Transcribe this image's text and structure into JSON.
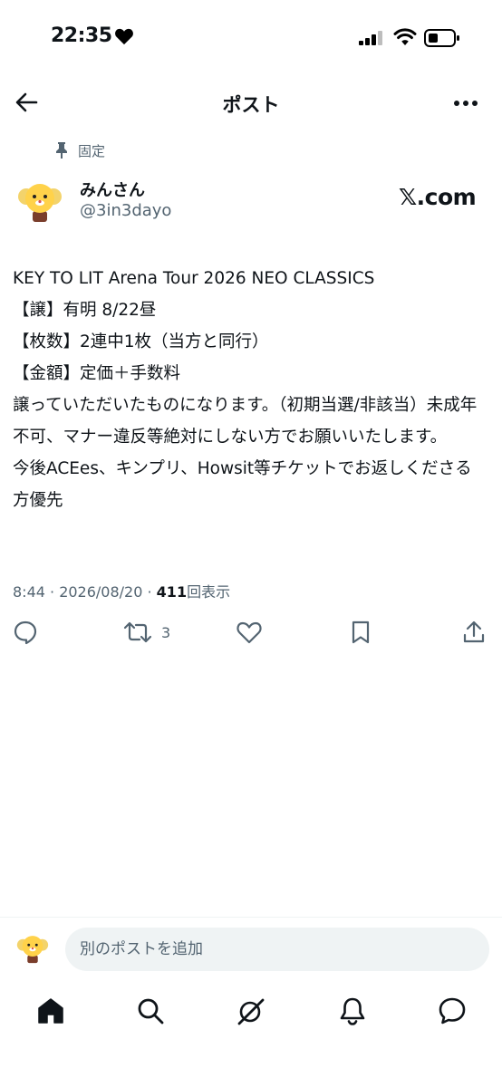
{
  "status_bar": {
    "time": "22:35",
    "icons": [
      "heart-icon",
      "signal-icon",
      "wifi-icon",
      "battery-icon"
    ]
  },
  "header": {
    "title": "ポスト",
    "icons": [
      "back-arrow-icon",
      "more-icon"
    ]
  },
  "post": {
    "pinned_label": "固定",
    "author": {
      "display_name": "みんさん",
      "handle": "@3in3dayo"
    },
    "source_logo": "𝕏.com",
    "body": "KEY TO LIT Arena Tour 2026 NEO CLASSICS\n【譲】有明 8/22昼\n【枚数】2連中1枚（当方と同行）\n【金額】定価＋手数料\n譲っていただいたものになります。（初期当選/非該当）未成年不可、マナー違反等絶対にしない方でお願いいたします。\n今後ACEes、キンプリ、Howsit等チケットでお返しくださる方優先",
    "meta": {
      "time_date": "8:44 · 2026/08/20 · ",
      "views_count": "411",
      "views_label": "回表示"
    },
    "actions": {
      "repost_count": "3",
      "icons": [
        "reply-icon",
        "repost-icon",
        "like-icon",
        "bookmark-icon",
        "share-icon"
      ]
    }
  },
  "compose": {
    "placeholder": "別のポストを追加"
  },
  "bottom_nav": {
    "icons": [
      "home-icon",
      "search-icon",
      "grok-icon",
      "notifications-icon",
      "messages-icon"
    ]
  },
  "colors": {
    "text": "#0f1419",
    "secondary": "#536471",
    "input_bg": "#eff3f4"
  }
}
